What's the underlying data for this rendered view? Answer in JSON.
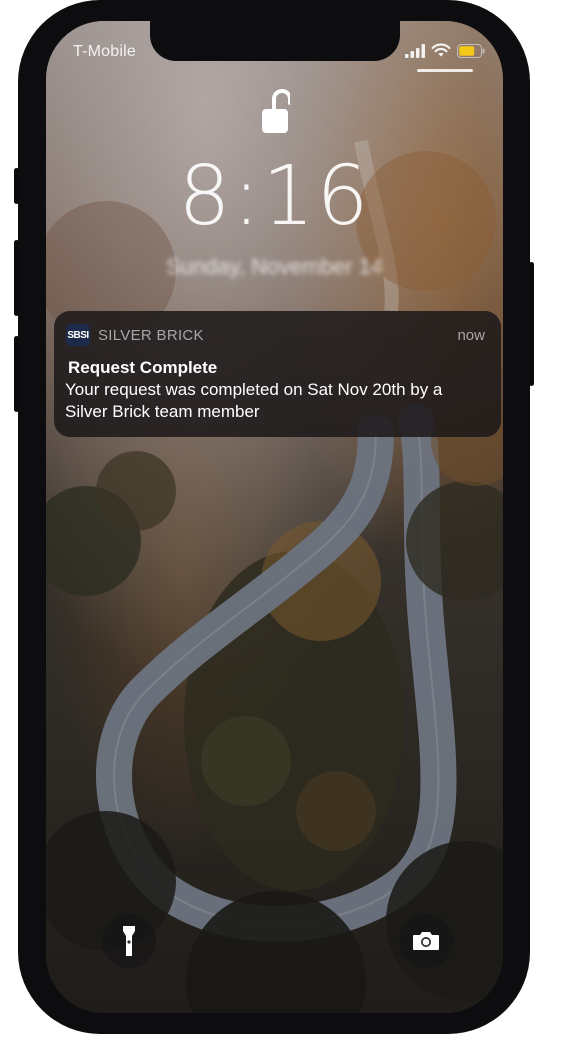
{
  "status_bar": {
    "carrier": "T-Mobile",
    "signal_icon": "signal-bars-icon",
    "wifi_icon": "wifi-icon",
    "battery_icon": "battery-icon",
    "battery_color": "#f4c81a"
  },
  "lock_screen": {
    "lock_icon": "unlocked-padlock-icon",
    "time": "8:16",
    "date": "Sunday, November 14"
  },
  "notification": {
    "app_icon_text": "SBSI",
    "app_name": "SILVER BRICK",
    "time_ago": "now",
    "title": "Request Complete",
    "body": "Your request was completed on Sat Nov 20th by a Silver Brick team member"
  },
  "bottom_controls": {
    "left_icon": "flashlight-icon",
    "right_icon": "camera-icon"
  }
}
